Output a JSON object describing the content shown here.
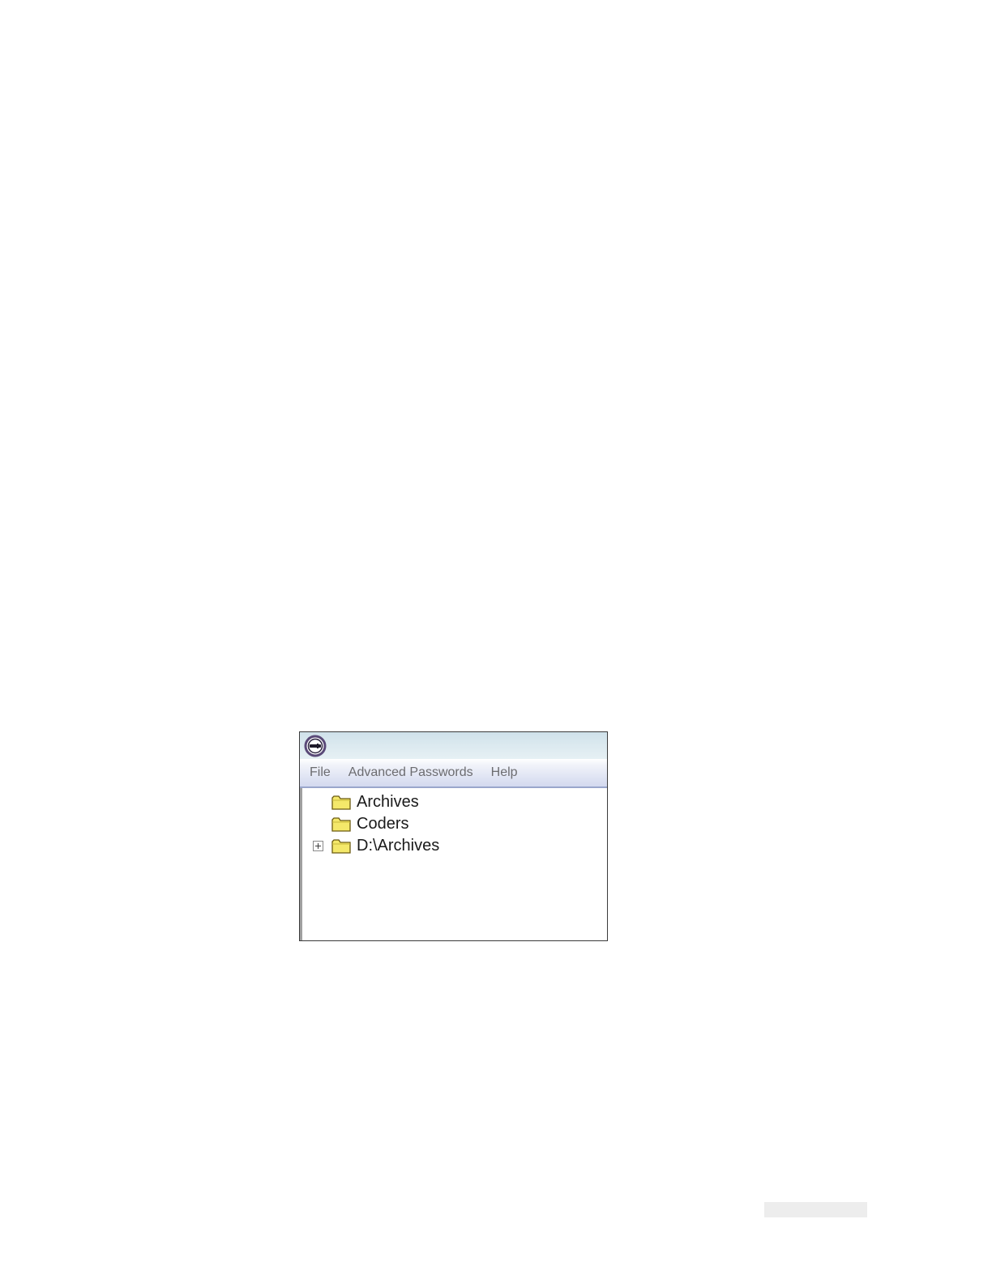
{
  "window": {
    "title": "",
    "icon": "key-lock-icon",
    "title_color": "#d8e4ea"
  },
  "menu": {
    "items": [
      {
        "label": "File"
      },
      {
        "label": "Advanced Passwords"
      },
      {
        "label": "Help"
      }
    ]
  },
  "tree": {
    "items": [
      {
        "label": "Archives",
        "icon": "folder-icon",
        "expandable": false
      },
      {
        "label": "Coders",
        "icon": "folder-icon",
        "expandable": false
      },
      {
        "label": "D:\\Archives",
        "icon": "folder-icon",
        "expandable": true
      }
    ]
  },
  "colors": {
    "folder_fill": "#f4e86a",
    "folder_outline": "#6b5a12",
    "icon_ring": "#5a4a78",
    "menu_text": "#6c6c70"
  }
}
